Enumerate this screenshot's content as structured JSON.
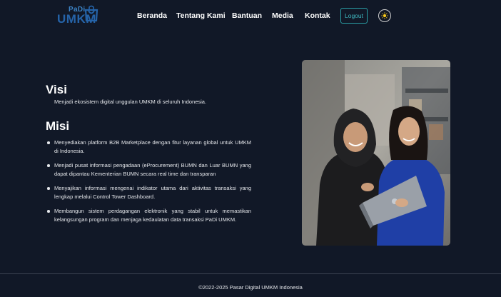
{
  "brand": {
    "logo_top": "PaDi",
    "logo_bottom": "UMKM",
    "color": "#2563a8"
  },
  "nav": {
    "items": [
      "Beranda",
      "Tentang Kami",
      "Bantuan",
      "Media",
      "Kontak"
    ],
    "logout_label": "Logout",
    "theme_icon": "sun-icon"
  },
  "visi": {
    "heading": "Visi",
    "text": "Menjadi ekosistem digital unggulan UMKM di seluruh Indonesia."
  },
  "misi": {
    "heading": "Misi",
    "items": [
      "Menyediakan platform B2B Marketplace dengan fitur layanan global untuk UMKM di Indonesia.",
      "Menjadi pusat informasi pengadaan (eProcurement) BUMN dan Luar BUMN yang dapat dipantau Kementerian BUMN secara real time dan transparan",
      "Menyajikan informasi mengenai indikator utama dari aktivitas transaksi yang lengkap melalui Control Tower Dashboard.",
      "Membangun sistem perdagangan elektronik yang stabil untuk memastikan kelangsungan program dan menjaga kedaulatan data transaksi PaDi UMKM."
    ]
  },
  "footer": {
    "text": "©2022-2025 Pasar Digital UMKM Indonesia"
  },
  "colors": {
    "background": "#111827",
    "accent": "#2aa1a8",
    "toggle_sun": "#f5c518"
  }
}
